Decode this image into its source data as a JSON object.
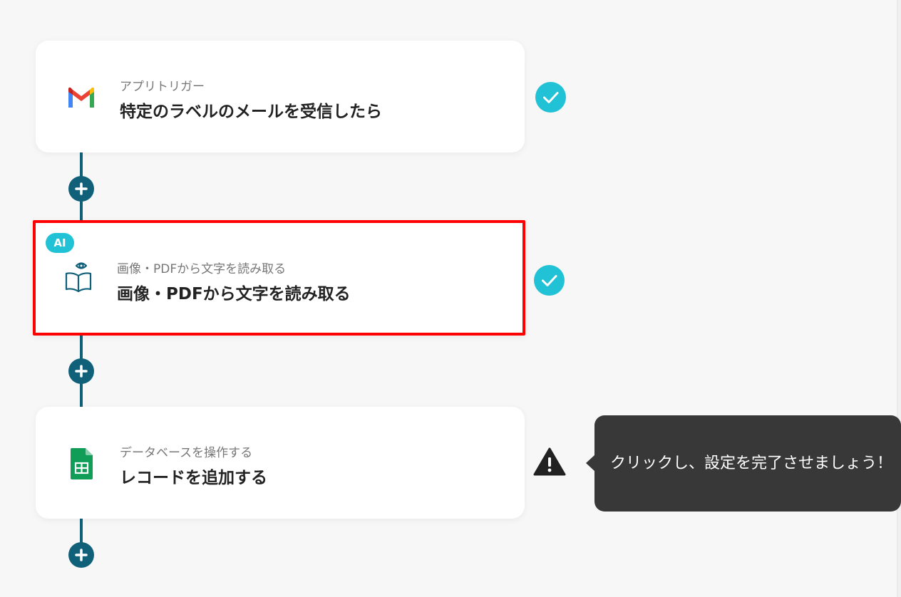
{
  "flow": {
    "steps": [
      {
        "subtitle": "アプリトリガー",
        "title": "特定のラベルのメールを受信したら",
        "icon": "gmail-icon",
        "status": "complete"
      },
      {
        "badge": "AI",
        "subtitle": "画像・PDFから文字を読み取る",
        "title": "画像・PDFから文字を読み取る",
        "icon": "ocr-book-eye-icon",
        "status": "complete"
      },
      {
        "subtitle": "データベースを操作する",
        "title": "レコードを追加する",
        "icon": "google-sheets-icon",
        "status": "warning"
      }
    ],
    "tooltip": "クリックし、設定を完了させましょう！"
  },
  "colors": {
    "accent": "#11607a",
    "check": "#21c1d6",
    "highlight": "#ff0000",
    "tooltip_bg": "#383838"
  }
}
